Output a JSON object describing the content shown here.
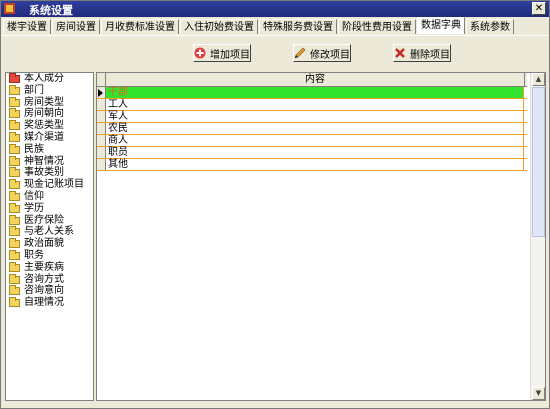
{
  "window": {
    "title": "系统设置",
    "close_label": "✕"
  },
  "tabs": [
    {
      "label": "楼宇设置",
      "active": false
    },
    {
      "label": "房间设置",
      "active": false
    },
    {
      "label": "月收费标准设置",
      "active": false
    },
    {
      "label": "入住初始费设置",
      "active": false
    },
    {
      "label": "特殊服务费设置",
      "active": false
    },
    {
      "label": "阶段性费用设置",
      "active": false
    },
    {
      "label": "数据字典",
      "active": true
    },
    {
      "label": "系统参数",
      "active": false
    }
  ],
  "toolbar": {
    "add_label": "增加项目",
    "edit_label": "修改项目",
    "delete_label": "删除项目"
  },
  "tree": {
    "items": [
      "本人成分",
      "部门",
      "房间类型",
      "房间朝向",
      "奖惩类型",
      "媒介渠道",
      "民族",
      "神智情况",
      "事故类别",
      "现金记账项目",
      "信仰",
      "学历",
      "医疗保险",
      "与老人关系",
      "政治面貌",
      "职务",
      "主要疾病",
      "咨询方式",
      "咨询意向",
      "自理情况"
    ],
    "selected_index": 0
  },
  "grid": {
    "column_header": "内容",
    "rows": [
      "干部",
      "工人",
      "军人",
      "农民",
      "商人",
      "职员",
      "其他"
    ],
    "selected_row": 0
  },
  "colors": {
    "selected_row_bg": "#33e32e",
    "selected_row_text": "#d2691e",
    "row_border": "#f0a020",
    "title_bar": "#2f3f9d"
  }
}
